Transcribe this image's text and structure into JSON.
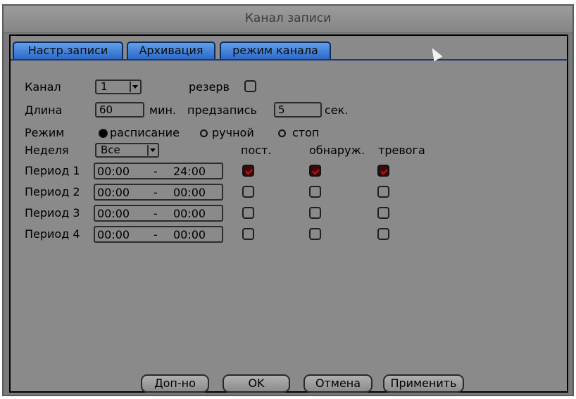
{
  "window": {
    "title": "Канал записи"
  },
  "tabs": [
    "Настр.записи",
    "Архивация",
    "режим канала"
  ],
  "form": {
    "channel_label": "Канал",
    "channel_value": "1",
    "reserve_label": "резерв",
    "length_label": "Длина",
    "length_value": "60",
    "min_label": "мин.",
    "prerecord_label": "предзапись",
    "prerecord_value": "5",
    "sec_label": "сек.",
    "mode_label": "Режим",
    "mode_options": [
      "расписание",
      "ручной",
      "стоп"
    ],
    "mode_selected": "расписание",
    "week_label": "Неделя",
    "week_value": "Все",
    "col_headers": [
      "пост.",
      "обнаруж.",
      "тревога"
    ]
  },
  "periods": [
    {
      "label": "Период 1",
      "start": "00:00",
      "sep": "-",
      "end": "24:00",
      "checks": [
        true,
        true,
        true
      ]
    },
    {
      "label": "Период 2",
      "start": "00:00",
      "sep": "-",
      "end": "00:00",
      "checks": [
        false,
        false,
        false
      ]
    },
    {
      "label": "Период 3",
      "start": "00:00",
      "sep": "-",
      "end": "00:00",
      "checks": [
        false,
        false,
        false
      ]
    },
    {
      "label": "Период 4",
      "start": "00:00",
      "sep": "-",
      "end": "00:00",
      "checks": [
        false,
        false,
        false
      ]
    }
  ],
  "buttons": [
    "Доп-но",
    "OK",
    "Отмена",
    "Применить"
  ],
  "colors": {
    "tab_active": "#5fa0ea",
    "panel_bg": "#8a8a8a",
    "check_mark": "#d01010"
  }
}
